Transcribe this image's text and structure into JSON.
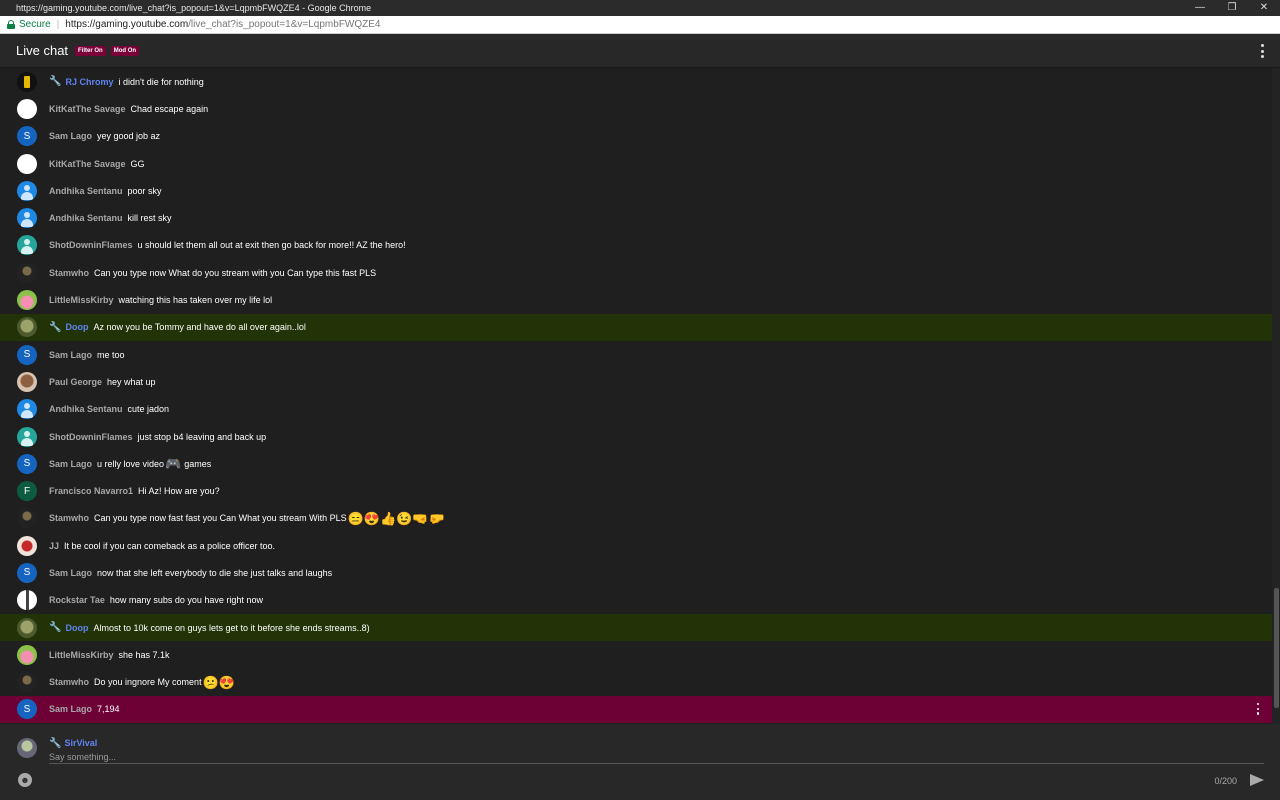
{
  "window": {
    "title": "https://gaming.youtube.com/live_chat?is_popout=1&v=LqpmbFWQZE4 - Google Chrome",
    "minimize": "—",
    "restore": "❐",
    "close": "✕"
  },
  "address": {
    "secure_label": "Secure",
    "url_host": "https://gaming.youtube.com",
    "url_path": "/live_chat?is_popout=1&v=LqpmbFWQZE4"
  },
  "header": {
    "title": "Live chat",
    "badges": [
      "Filter On",
      "Mod On"
    ]
  },
  "messages": [
    {
      "author": "RJ Chromy",
      "text": "i didn't die for nothing",
      "mod": true,
      "avatar": "av-yellow",
      "initial": ""
    },
    {
      "author": "KitKatThe Savage",
      "text": "Chad escape again",
      "mod": false,
      "avatar": "av-white",
      "initial": ""
    },
    {
      "author": "Sam Lago",
      "text": "yey good job az",
      "mod": false,
      "avatar": "av-s",
      "initial": "S"
    },
    {
      "author": "KitKatThe Savage",
      "text": "GG",
      "mod": false,
      "avatar": "av-white",
      "initial": ""
    },
    {
      "author": "Andhika Sentanu",
      "text": "poor sky",
      "mod": false,
      "avatar": "av-user",
      "initial": ""
    },
    {
      "author": "Andhika Sentanu",
      "text": "kill rest sky",
      "mod": false,
      "avatar": "av-user",
      "initial": ""
    },
    {
      "author": "ShotDowninFlames",
      "text": "u should let them all out at exit then go back for more!! AZ the hero!",
      "mod": false,
      "avatar": "av-teal",
      "initial": ""
    },
    {
      "author": "Stamwho",
      "text": "Can you type now What do you stream with you Can type this fast PLS",
      "mod": false,
      "avatar": "av-dark",
      "initial": ""
    },
    {
      "author": "LittleMissKirby",
      "text": "watching this has taken over my life lol",
      "mod": false,
      "avatar": "av-kirby",
      "initial": ""
    },
    {
      "author": "Doop",
      "text": "Az now you be Tommy and have do all over again..lol",
      "mod": true,
      "highlight": true,
      "avatar": "av-green",
      "initial": ""
    },
    {
      "author": "Sam Lago",
      "text": "me too",
      "mod": false,
      "avatar": "av-s",
      "initial": "S"
    },
    {
      "author": "Paul George",
      "text": "hey what up",
      "mod": false,
      "avatar": "av-face",
      "initial": ""
    },
    {
      "author": "Andhika Sentanu",
      "text": "cute jadon",
      "mod": false,
      "avatar": "av-user",
      "initial": ""
    },
    {
      "author": "ShotDowninFlames",
      "text": "just stop b4 leaving and back up",
      "mod": false,
      "avatar": "av-teal",
      "initial": ""
    },
    {
      "author": "Sam Lago",
      "text": "u relly love video",
      "emoji": "🎮",
      "after": "games",
      "mod": false,
      "avatar": "av-s",
      "initial": "S"
    },
    {
      "author": "Francisco Navarro1",
      "text": "Hi Az! How are you?",
      "mod": false,
      "avatar": "av-f",
      "initial": "F"
    },
    {
      "author": "Stamwho",
      "text": "Can you type now fast fast you Can What you stream With PLS",
      "emoji": "😑😍👍😉🤜🤛",
      "after": "",
      "mod": false,
      "avatar": "av-dark",
      "initial": ""
    },
    {
      "author": "JJ",
      "text": "It be cool if you can comeback as a police officer too.",
      "mod": false,
      "avatar": "av-red",
      "initial": ""
    },
    {
      "author": "Sam Lago",
      "text": "now that she left everybody to die she just talks and laughs",
      "mod": false,
      "avatar": "av-s",
      "initial": "S"
    },
    {
      "author": "Rockstar Tae",
      "text": "how many subs do you have right now",
      "mod": false,
      "avatar": "av-bw",
      "initial": ""
    },
    {
      "author": "Doop",
      "text": "Almost to 10k come on guys lets get to it before she ends streams..8)",
      "mod": true,
      "highlight": true,
      "avatar": "av-green",
      "initial": ""
    },
    {
      "author": "LittleMissKirby",
      "text": "she has 7.1k",
      "mod": false,
      "avatar": "av-kirby",
      "initial": ""
    },
    {
      "author": "Stamwho",
      "text": "Do you ingnore My coment",
      "emoji": "😕😍",
      "after": "",
      "mod": false,
      "avatar": "av-dark",
      "initial": ""
    },
    {
      "author": "Sam Lago",
      "text": "7,194",
      "mod": false,
      "pinned": true,
      "avatar": "av-s",
      "initial": "S"
    }
  ],
  "composer": {
    "username": "SirVival",
    "placeholder": "Say something...",
    "counter": "0/200"
  },
  "icons": {
    "mod": "wrench-icon",
    "emoji": "smiley-icon",
    "send": "send-icon"
  },
  "colors": {
    "mod_name": "#5e84f1",
    "highlight_row": "#233308",
    "pinned_row": "#6d0135",
    "badge": "#7a0038"
  }
}
